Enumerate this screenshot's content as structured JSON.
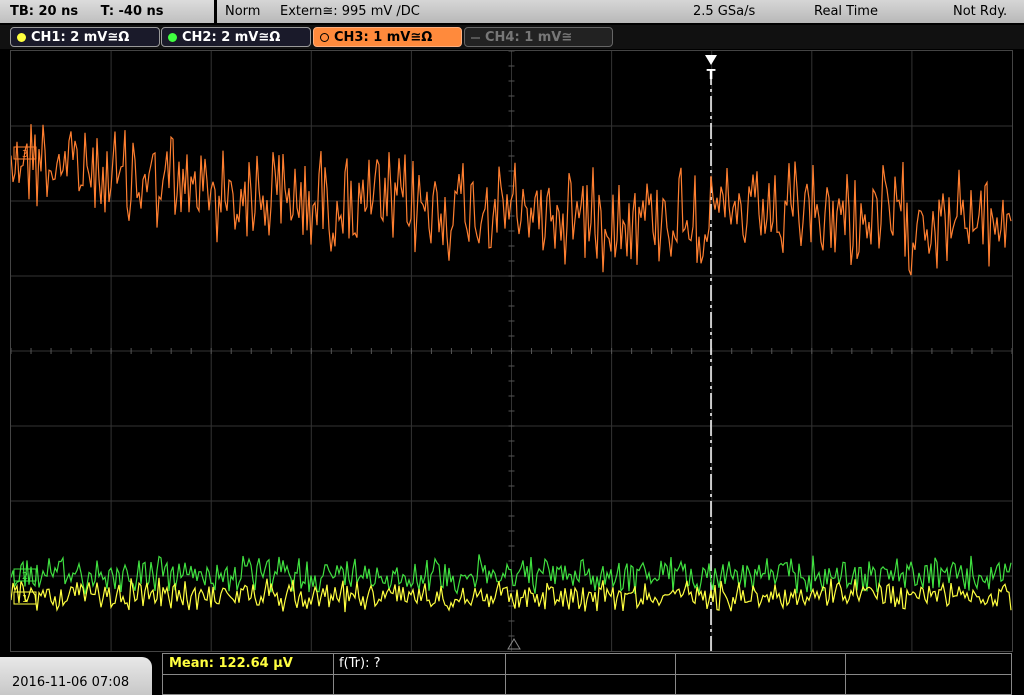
{
  "status": {
    "tb": "TB: 20 ns",
    "t": "T: -40 ns",
    "mode": "Norm",
    "trigger": "Extern≅: 995 mV ∕DC",
    "rate": "2.5 GSa/s",
    "acq": "Real Time",
    "ready": "Not Rdy."
  },
  "channels": [
    {
      "label": "CH1: 2 mV≅Ω",
      "color": "#ffff40"
    },
    {
      "label": "CH2: 2 mV≅Ω",
      "color": "#40ff40"
    },
    {
      "label": "CH3: 1 mV≅Ω",
      "color": "#ff8a3c"
    },
    {
      "label": "CH4: 1 mV≅",
      "color": "#777777"
    }
  ],
  "trigger_marker": "T",
  "markers": {
    "ch3": "3",
    "ch2": "2",
    "ch1": "1"
  },
  "bottom": {
    "date": "2016-11-06 07:08",
    "mean": "Mean: 122.64 µV",
    "ftr": "f(Tr): ?"
  },
  "colors": {
    "ch1": "#ffff40",
    "ch2": "#40e040",
    "ch3": "#ff7f30",
    "grid": "#3a3a3a"
  }
}
